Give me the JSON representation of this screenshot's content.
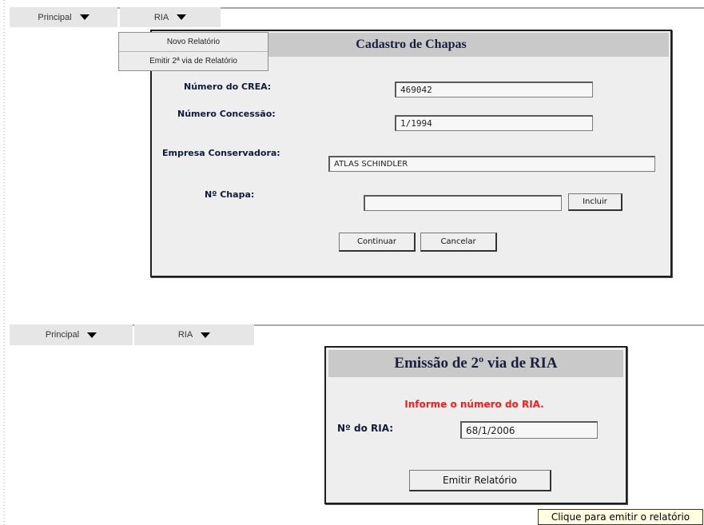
{
  "top": {
    "menu": {
      "principal": "Principal",
      "ria": "RIA"
    },
    "dropdown": {
      "items": [
        "Novo Relatório",
        "Emitir 2ª via de Relatório"
      ]
    },
    "panel": {
      "title": "Cadastro de Chapas",
      "crea_label": "Número do CREA:",
      "crea_value": "469042",
      "concessao_label": "Número Concessão:",
      "concessao_value": "1/1994",
      "empresa_label": "Empresa Conservadora:",
      "empresa_value": "ATLAS SCHINDLER",
      "chapa_label": "Nº Chapa:",
      "chapa_value": "",
      "incluir_label": "Incluir",
      "continuar_label": "Continuar",
      "cancelar_label": "Cancelar"
    }
  },
  "bottom": {
    "menu": {
      "principal": "Principal",
      "ria": "RIA"
    },
    "panel": {
      "title": "Emissão de 2º via de RIA",
      "message": "Informe o número do RIA.",
      "ria_label": "Nº do RIA:",
      "ria_value": "68/1/2006",
      "emitir_label": "Emitir Relatório"
    },
    "tooltip": "Clique para emitir o relatório"
  },
  "colors": {
    "message": "#ff1a1a",
    "title_bar": "#c9c9c9",
    "panel_bg": "#eeeeee"
  }
}
